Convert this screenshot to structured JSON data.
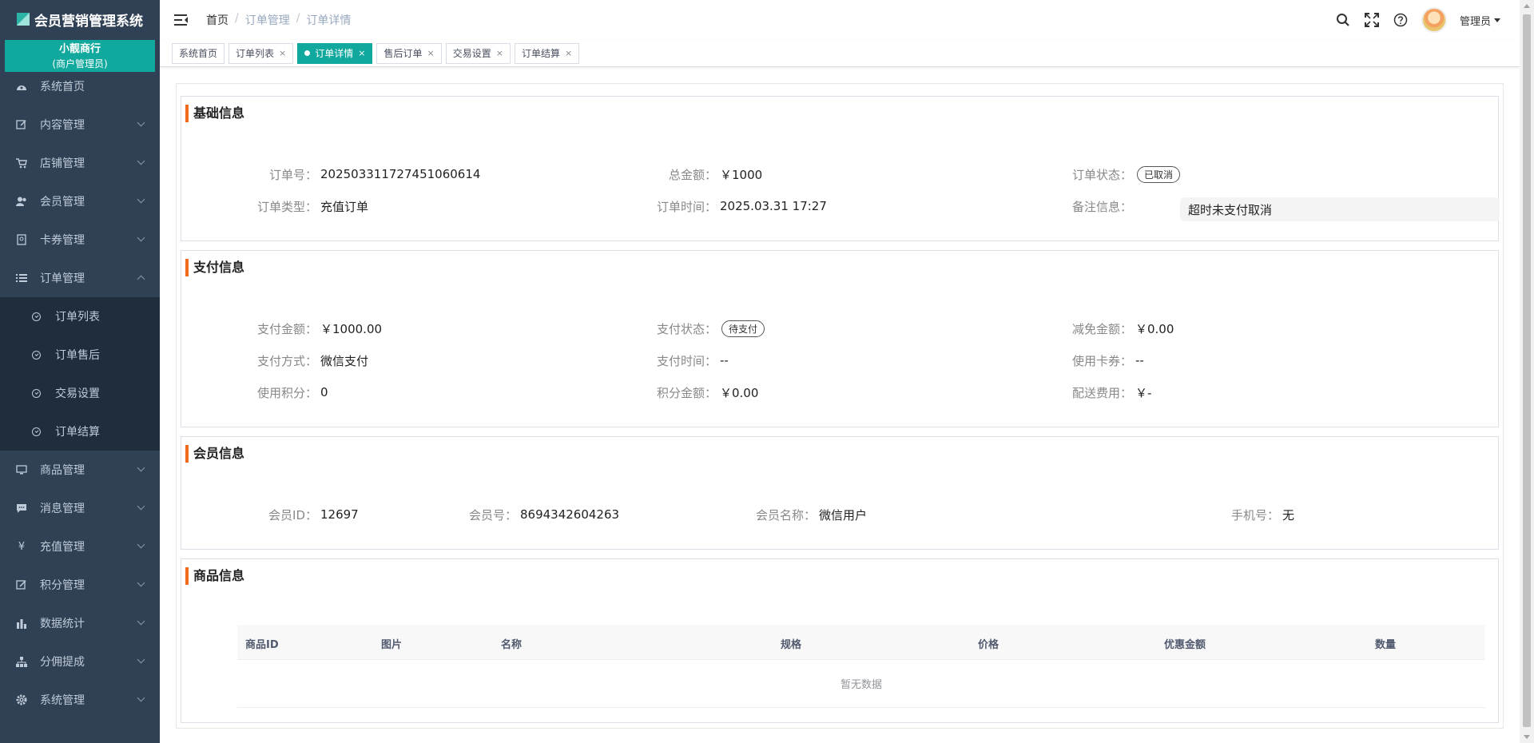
{
  "app": {
    "title": "会员营销管理系统"
  },
  "shop": {
    "name": "小靓商行",
    "role": "(商户管理员)"
  },
  "sidebar": {
    "items": [
      {
        "label": "系统首页",
        "icon": "dashboard-icon"
      },
      {
        "label": "内容管理",
        "icon": "edit-icon"
      },
      {
        "label": "店铺管理",
        "icon": "cart-icon"
      },
      {
        "label": "会员管理",
        "icon": "users-icon"
      },
      {
        "label": "卡券管理",
        "icon": "card-icon"
      },
      {
        "label": "订单管理",
        "icon": "list-icon",
        "expanded": true
      },
      {
        "label": "商品管理",
        "icon": "monitor-icon"
      },
      {
        "label": "消息管理",
        "icon": "message-icon"
      },
      {
        "label": "充值管理",
        "icon": "yen-icon"
      },
      {
        "label": "积分管理",
        "icon": "points-icon"
      },
      {
        "label": "数据统计",
        "icon": "bar-chart-icon"
      },
      {
        "label": "分佣提成",
        "icon": "hierarchy-icon"
      },
      {
        "label": "系统管理",
        "icon": "gear-icon"
      }
    ],
    "order_sub": [
      "订单列表",
      "订单售后",
      "交易设置",
      "订单结算"
    ]
  },
  "breadcrumb": [
    "首页",
    "订单管理",
    "订单详情"
  ],
  "header": {
    "user": "管理员"
  },
  "tags": [
    {
      "label": "系统首页",
      "closable": false
    },
    {
      "label": "订单列表",
      "closable": true
    },
    {
      "label": "订单详情",
      "closable": true,
      "active": true
    },
    {
      "label": "售后订单",
      "closable": true
    },
    {
      "label": "交易设置",
      "closable": true
    },
    {
      "label": "订单结算",
      "closable": true
    }
  ],
  "basic": {
    "title": "基础信息",
    "order_no_label": "订单号：",
    "order_no": "202503311727451060614",
    "total_label": "总金额：",
    "total": "￥1000",
    "status_label": "订单状态：",
    "status": "已取消",
    "type_label": "订单类型：",
    "type": "充值订单",
    "time_label": "订单时间：",
    "time": "2025.03.31 17:27",
    "remark_label": "备注信息：",
    "remark": "超时未支付取消"
  },
  "payment": {
    "title": "支付信息",
    "amount_label": "支付金额：",
    "amount": "￥1000.00",
    "status_label": "支付状态：",
    "status": "待支付",
    "discount_label": "减免金额：",
    "discount": "￥0.00",
    "method_label": "支付方式：",
    "method": "微信支付",
    "pay_time_label": "支付时间：",
    "pay_time": "--",
    "coupon_label": "使用卡券：",
    "coupon": "--",
    "points_label": "使用积分：",
    "points": "0",
    "points_amount_label": "积分金额：",
    "points_amount": "￥0.00",
    "delivery_label": "配送费用：",
    "delivery": "￥-"
  },
  "member": {
    "title": "会员信息",
    "id_label": "会员ID：",
    "id": "12697",
    "no_label": "会员号：",
    "no": "8694342604263",
    "name_label": "会员名称：",
    "name": "微信用户",
    "phone_label": "手机号：",
    "phone": "无"
  },
  "goods": {
    "title": "商品信息",
    "columns": [
      "商品ID",
      "图片",
      "名称",
      "规格",
      "价格",
      "优惠金额",
      "数量"
    ],
    "empty": "暂无数据"
  },
  "colors": {
    "sidebar_bg": "#304156",
    "accent": "#11a89d",
    "title_bar": "#f26b1d"
  }
}
